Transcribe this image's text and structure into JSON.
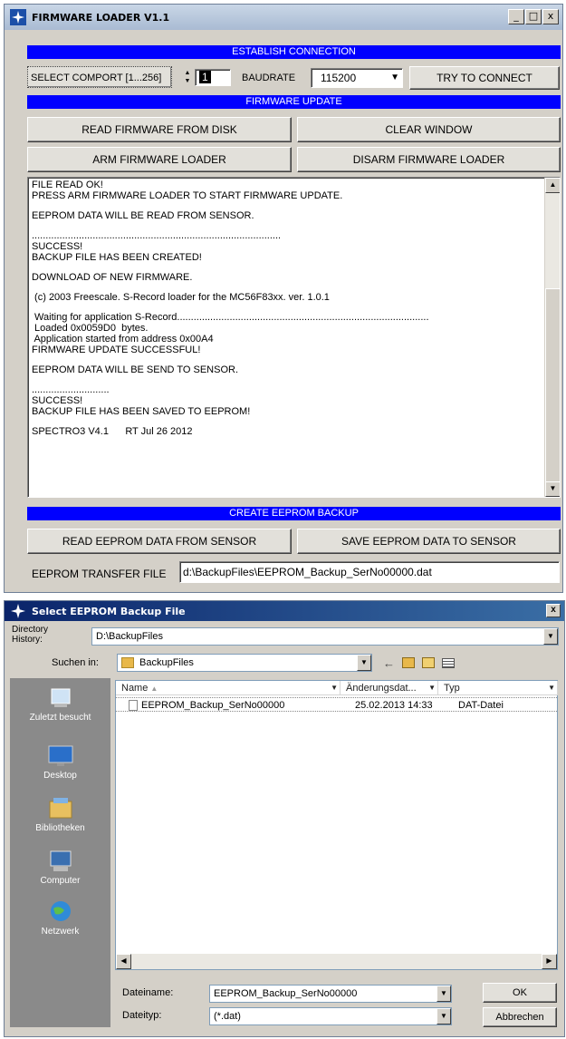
{
  "loader": {
    "title": "FIRMWARE LOADER V1.1",
    "window_buttons": {
      "minimize": "_",
      "maximize": "□",
      "close": "x"
    },
    "establish_header": "ESTABLISH CONNECTION",
    "comport_label": "SELECT COMPORT [1...256]",
    "comport_value": "1",
    "baudrate_label": "BAUDRATE",
    "baudrate_value": "115200",
    "connect_button": "TRY TO CONNECT",
    "firmware_header": "FIRMWARE UPDATE",
    "read_fw_button": "READ FIRMWARE FROM DISK",
    "clear_button": "CLEAR WINDOW",
    "arm_button": "ARM FIRMWARE LOADER",
    "disarm_button": "DISARM FIRMWARE LOADER",
    "log_lines": [
      "FILE READ OK!",
      "PRESS ARM FIRMWARE LOADER TO START FIRMWARE UPDATE.",
      "",
      "EEPROM DATA WILL BE READ FROM SENSOR.",
      "",
      "..........................................................................................",
      "SUCCESS!",
      "BACKUP FILE HAS BEEN CREATED!",
      "",
      "DOWNLOAD OF NEW FIRMWARE.",
      "",
      " (c) 2003 Freescale. S-Record loader for the MC56F83xx. ver. 1.0.1",
      "",
      " Waiting for application S-Record...........................................................................................",
      " Loaded 0x0059D0  bytes.",
      " Application started from address 0x00A4",
      "FIRMWARE UPDATE SUCCESSFUL!",
      "",
      "EEPROM DATA WILL BE SEND TO SENSOR.",
      "",
      "............................",
      "SUCCESS!",
      "BACKUP FILE HAS BEEN SAVED TO EEPROM!",
      "",
      "SPECTRO3 V4.1      RT Jul 26 2012"
    ],
    "backup_header": "CREATE EEPROM BACKUP",
    "read_eeprom_button": "READ EEPROM DATA FROM SENSOR",
    "save_eeprom_button": "SAVE EEPROM DATA TO SENSOR",
    "transfer_label": "EEPROM TRANSFER FILE",
    "transfer_value": "d:\\BackupFiles\\EEPROM_Backup_SerNo00000.dat"
  },
  "dialog": {
    "title": "Select EEPROM Backup File",
    "close": "x",
    "history_label": "Directory\nHistory:",
    "history_value": "D:\\BackupFiles",
    "search_label": "Suchen in:",
    "search_value": "BackupFiles",
    "places": [
      "Zuletzt besucht",
      "Desktop",
      "Bibliotheken",
      "Computer",
      "Netzwerk"
    ],
    "columns": [
      "Name",
      "Änderungsdat...",
      "Typ"
    ],
    "files": [
      {
        "name": "EEPROM_Backup_SerNo00000",
        "date": "25.02.2013 14:33",
        "type": "DAT-Datei"
      }
    ],
    "filename_label": "Dateiname:",
    "filename_value": "EEPROM_Backup_SerNo00000",
    "filetype_label": "Dateityp:",
    "filetype_value": "(*.dat)",
    "ok_button": "OK",
    "cancel_button": "Abbrechen"
  }
}
